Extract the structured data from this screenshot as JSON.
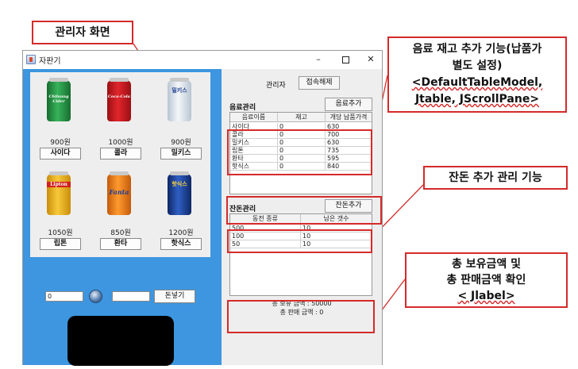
{
  "annotations": {
    "admin_screen": "관리자 화면",
    "drink_stock": [
      "음료 재고 추가 기능(납품가",
      "별도 설정)",
      "<DefaultTableModel,",
      "Jtable, JScrollPane>"
    ],
    "change_manage": "잔돈 추가 관리 기능",
    "totals_check": [
      "총 보유금액 및",
      "총 판매금액 확인",
      "< Jlabel>"
    ]
  },
  "window": {
    "title": "자판기",
    "minimize": "–",
    "close": "✕"
  },
  "products": [
    {
      "name": "사이다",
      "price": "900원",
      "can_text": "Chilsung Cider",
      "color": "#1f8a3c"
    },
    {
      "name": "콜라",
      "price": "1000원",
      "can_text": "Coca-Cola",
      "color": "#c8171e"
    },
    {
      "name": "밀키스",
      "price": "900원",
      "can_text": "밀키스",
      "color": "#dfe7ef"
    },
    {
      "name": "립톤",
      "price": "1050원",
      "can_text": "Lipton",
      "color": "#f0b51a"
    },
    {
      "name": "환타",
      "price": "850원",
      "can_text": "Fanta",
      "color": "#ee7e18"
    },
    {
      "name": "핫식스",
      "price": "1200원",
      "can_text": "핫식스",
      "color": "#1c3e8f"
    }
  ],
  "coin": {
    "inserted_value": "0",
    "insert_button": "돈넣기"
  },
  "admin": {
    "label": "관리자",
    "logout_button": "접속해제",
    "drink_section": {
      "title": "음료관리",
      "add_button": "음료추가",
      "columns": [
        "음료이름",
        "재고",
        "개당 납품가격"
      ],
      "rows": [
        [
          "사이다",
          "0",
          "630"
        ],
        [
          "콜라",
          "0",
          "700"
        ],
        [
          "밀키스",
          "0",
          "630"
        ],
        [
          "립톤",
          "0",
          "735"
        ],
        [
          "환타",
          "0",
          "595"
        ],
        [
          "핫식스",
          "0",
          "840"
        ]
      ]
    },
    "change_section": {
      "title": "잔돈관리",
      "add_button": "잔돈추가",
      "columns": [
        "동전 종류",
        "남은 갯수"
      ],
      "rows": [
        [
          "500",
          "10"
        ],
        [
          "100",
          "10"
        ],
        [
          "50",
          "10"
        ]
      ]
    },
    "total_balance": "총 보유 금액 : 50000",
    "total_sales": "총 판매 금액 : 0"
  },
  "colors": {
    "machine_blue": "#3d96df",
    "annotation_red": "#d52a2a",
    "panel_gray": "#eeeeee"
  }
}
